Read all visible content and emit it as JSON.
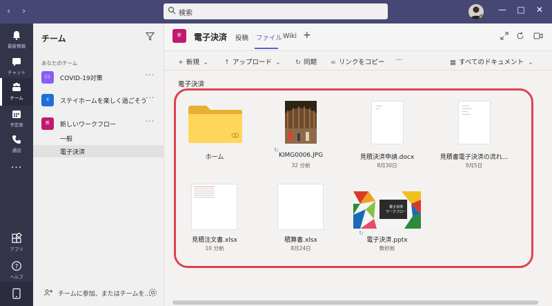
{
  "titlebar": {
    "search_placeholder": "検索",
    "back_icon": "chevron-left-icon",
    "forward_icon": "chevron-right-icon",
    "accent_color": "#464775"
  },
  "rail": {
    "items": [
      {
        "label": "最新情報",
        "icon": "bell-icon"
      },
      {
        "label": "チャット",
        "icon": "chat-icon"
      },
      {
        "label": "チーム",
        "icon": "teams-icon"
      },
      {
        "label": "予定表",
        "icon": "calendar-icon"
      },
      {
        "label": "通話",
        "icon": "phone-icon"
      },
      {
        "label": "アプリ",
        "icon": "apps-icon"
      },
      {
        "label": "ヘルプ",
        "icon": "help-icon"
      }
    ]
  },
  "teams_panel": {
    "title": "チーム",
    "section_label": "あなたのチーム",
    "teams": [
      {
        "name": "COVID-19対策",
        "avatar": "C1",
        "color": "#8b5cf6"
      },
      {
        "name": "ステイホームを楽しく過ごそう",
        "avatar": "X",
        "color": "#1f6fd6"
      },
      {
        "name": "新しいワークフロー",
        "avatar": "新",
        "color": "#c2186f"
      }
    ],
    "channels": [
      "一般",
      "電子決済"
    ],
    "join_text": "チームに参加、またはチームを..."
  },
  "channel_header": {
    "avatar": "新",
    "name": "電子決済",
    "tabs": [
      "投稿",
      "ファイル",
      "Wiki"
    ],
    "active_tab": "ファイル",
    "add_tab": "+"
  },
  "toolbar": {
    "new": "新規",
    "upload": "アップロード",
    "sync": "同期",
    "copy_link": "リンクをコピー",
    "more": "···",
    "view": "すべてのドキュメント"
  },
  "breadcrumb": "電子決済",
  "files": [
    {
      "name": "ホーム",
      "meta": "",
      "kind": "folder"
    },
    {
      "name": "KIMG0006.JPG",
      "meta": "32 分前",
      "kind": "photo"
    },
    {
      "name": "見積決済申請.docx",
      "meta": "8月30日",
      "kind": "doc"
    },
    {
      "name": "見積書電子決済の流れ...",
      "meta": "9月5日",
      "kind": "doc"
    },
    {
      "name": "見積注文書.xlsx",
      "meta": "10 分前",
      "kind": "sheet"
    },
    {
      "name": "積算書.xlsx",
      "meta": "8月24日",
      "kind": "blank"
    },
    {
      "name": "電子決済.pptx",
      "meta": "数秒前",
      "kind": "slide"
    }
  ],
  "slide_thumb_text": "電子決済\nワークフロー"
}
